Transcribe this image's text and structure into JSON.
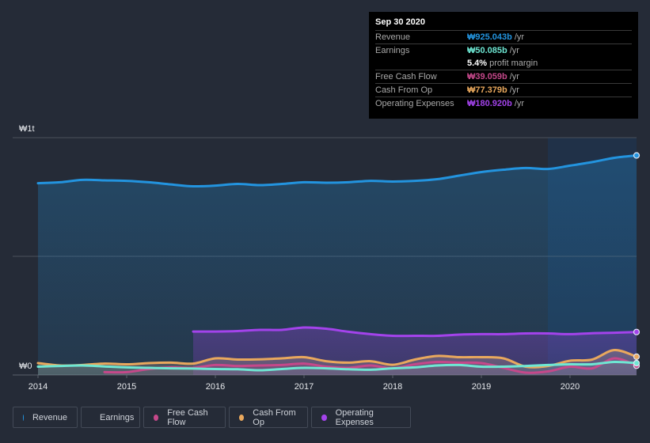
{
  "tooltip": {
    "date": "Sep 30 2020",
    "rows": [
      {
        "label": "Revenue",
        "value": "₩925.043b",
        "unit": "/yr",
        "color": "#2394df"
      },
      {
        "label": "Earnings",
        "value": "₩50.085b",
        "unit": "/yr",
        "color": "#6ee7d3"
      },
      {
        "label": "",
        "value": "5.4%",
        "unit": "profit margin",
        "color": "#ffffff"
      },
      {
        "label": "Free Cash Flow",
        "value": "₩39.059b",
        "unit": "/yr",
        "color": "#c5488a"
      },
      {
        "label": "Cash From Op",
        "value": "₩77.379b",
        "unit": "/yr",
        "color": "#e9a85d"
      },
      {
        "label": "Operating Expenses",
        "value": "₩180.920b",
        "unit": "/yr",
        "color": "#a343eb"
      }
    ]
  },
  "legend": [
    {
      "label": "Revenue",
      "color": "#2394df"
    },
    {
      "label": "Earnings",
      "color": "#6ee7d3"
    },
    {
      "label": "Free Cash Flow",
      "color": "#c5488a"
    },
    {
      "label": "Cash From Op",
      "color": "#e9a85d"
    },
    {
      "label": "Operating Expenses",
      "color": "#a343eb"
    }
  ],
  "chart_data": {
    "type": "area",
    "title": "",
    "xlabel": "",
    "ylabel": "",
    "y_tick_labels": [
      "₩0",
      "₩1t"
    ],
    "ylim": [
      0,
      1000
    ],
    "y_unit": "₩ billions",
    "x_tick_labels": [
      "2014",
      "2015",
      "2016",
      "2017",
      "2018",
      "2019",
      "2020"
    ],
    "xlim": [
      2014.0,
      2020.75
    ],
    "grid": true,
    "forecast_shade_from": 2020.0,
    "series": [
      {
        "name": "Revenue",
        "color": "#2394df",
        "x": [
          2014.0,
          2014.25,
          2014.5,
          2014.75,
          2015.0,
          2015.25,
          2015.5,
          2015.75,
          2016.0,
          2016.25,
          2016.5,
          2016.75,
          2017.0,
          2017.25,
          2017.5,
          2017.75,
          2018.0,
          2018.25,
          2018.5,
          2018.75,
          2019.0,
          2019.25,
          2019.5,
          2019.75,
          2020.0,
          2020.25,
          2020.5,
          2020.75
        ],
        "values": [
          808,
          812,
          822,
          820,
          818,
          812,
          803,
          795,
          798,
          805,
          800,
          805,
          812,
          810,
          812,
          818,
          815,
          818,
          825,
          840,
          855,
          865,
          872,
          868,
          882,
          897,
          915,
          925
        ]
      },
      {
        "name": "Operating Expenses",
        "color": "#a343eb",
        "x": [
          2015.75,
          2016.0,
          2016.25,
          2016.5,
          2016.75,
          2017.0,
          2017.25,
          2017.5,
          2017.75,
          2018.0,
          2018.25,
          2018.5,
          2018.75,
          2019.0,
          2019.25,
          2019.5,
          2019.75,
          2020.0,
          2020.25,
          2020.5,
          2020.75
        ],
        "values": [
          183,
          183,
          185,
          190,
          190,
          200,
          195,
          182,
          172,
          165,
          165,
          165,
          170,
          172,
          172,
          175,
          175,
          172,
          176,
          178,
          181
        ]
      },
      {
        "name": "Cash From Op",
        "color": "#e9a85d",
        "x": [
          2014.0,
          2014.25,
          2014.5,
          2014.75,
          2015.0,
          2015.25,
          2015.5,
          2015.75,
          2016.0,
          2016.25,
          2016.5,
          2016.75,
          2017.0,
          2017.25,
          2017.5,
          2017.75,
          2018.0,
          2018.25,
          2018.5,
          2018.75,
          2019.0,
          2019.25,
          2019.5,
          2019.75,
          2020.0,
          2020.25,
          2020.5,
          2020.75
        ],
        "values": [
          50,
          40,
          42,
          48,
          45,
          50,
          52,
          48,
          70,
          65,
          66,
          70,
          75,
          58,
          52,
          58,
          43,
          65,
          80,
          75,
          75,
          70,
          35,
          38,
          60,
          65,
          105,
          77
        ]
      },
      {
        "name": "Free Cash Flow",
        "color": "#c5488a",
        "x": [
          2014.75,
          2015.0,
          2015.25,
          2015.5,
          2015.75,
          2016.0,
          2016.25,
          2016.5,
          2016.75,
          2017.0,
          2017.25,
          2017.5,
          2017.75,
          2018.0,
          2018.25,
          2018.5,
          2018.75,
          2019.0,
          2019.25,
          2019.5,
          2019.75,
          2020.0,
          2020.25,
          2020.5,
          2020.75
        ],
        "values": [
          12,
          12,
          25,
          32,
          30,
          42,
          38,
          40,
          42,
          48,
          35,
          30,
          40,
          28,
          45,
          55,
          52,
          50,
          30,
          10,
          15,
          35,
          28,
          70,
          39
        ]
      },
      {
        "name": "Earnings",
        "color": "#6ee7d3",
        "x": [
          2014.0,
          2014.25,
          2014.5,
          2014.75,
          2015.0,
          2015.25,
          2015.5,
          2015.75,
          2016.0,
          2016.25,
          2016.5,
          2016.75,
          2017.0,
          2017.25,
          2017.5,
          2017.75,
          2018.0,
          2018.25,
          2018.5,
          2018.75,
          2019.0,
          2019.25,
          2019.5,
          2019.75,
          2020.0,
          2020.25,
          2020.5,
          2020.75
        ],
        "values": [
          35,
          38,
          40,
          36,
          32,
          30,
          28,
          27,
          25,
          24,
          20,
          25,
          30,
          28,
          24,
          22,
          28,
          32,
          40,
          42,
          35,
          35,
          38,
          42,
          45,
          45,
          55,
          50
        ]
      }
    ]
  }
}
